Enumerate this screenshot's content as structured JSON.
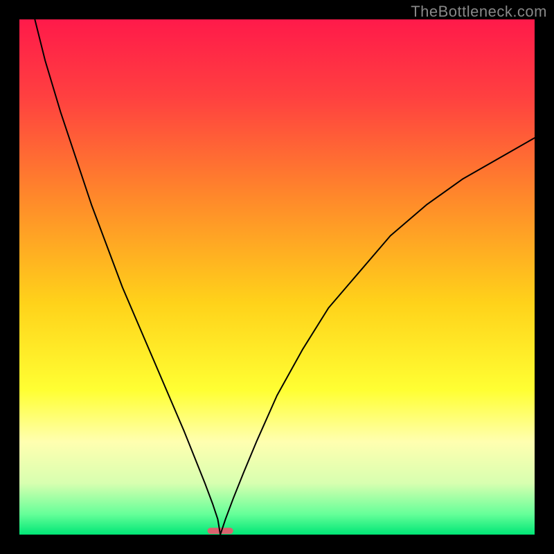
{
  "watermark": "TheBottleneck.com",
  "chart_data": {
    "type": "line",
    "title": "",
    "xlabel": "",
    "ylabel": "",
    "xlim": [
      0,
      100
    ],
    "ylim": [
      0,
      100
    ],
    "grid": false,
    "legend": false,
    "background_gradient": {
      "stops": [
        {
          "offset": 0,
          "color": "#ff1a4a"
        },
        {
          "offset": 15,
          "color": "#ff4040"
        },
        {
          "offset": 35,
          "color": "#ff8a2a"
        },
        {
          "offset": 55,
          "color": "#ffd21a"
        },
        {
          "offset": 72,
          "color": "#ffff33"
        },
        {
          "offset": 82,
          "color": "#ffffb0"
        },
        {
          "offset": 90,
          "color": "#d8ffb0"
        },
        {
          "offset": 96,
          "color": "#66ff99"
        },
        {
          "offset": 100,
          "color": "#00e676"
        }
      ]
    },
    "minimum_marker": {
      "x": 39,
      "y": 0,
      "color": "#d9636e",
      "width": 5,
      "height": 1.2
    },
    "series": [
      {
        "name": "left-branch",
        "x": [
          3,
          5,
          8,
          11,
          14,
          17,
          20,
          23,
          26,
          29,
          32,
          34,
          36,
          37.5,
          38.5,
          39
        ],
        "y": [
          100,
          92,
          82,
          73,
          64,
          56,
          48,
          41,
          34,
          27,
          20,
          15,
          10,
          6,
          3,
          0
        ]
      },
      {
        "name": "right-branch",
        "x": [
          39,
          40,
          41.5,
          43.5,
          46,
          50,
          55,
          60,
          66,
          72,
          79,
          86,
          93,
          100
        ],
        "y": [
          0,
          3,
          7,
          12,
          18,
          27,
          36,
          44,
          51,
          58,
          64,
          69,
          73,
          77
        ]
      }
    ]
  }
}
